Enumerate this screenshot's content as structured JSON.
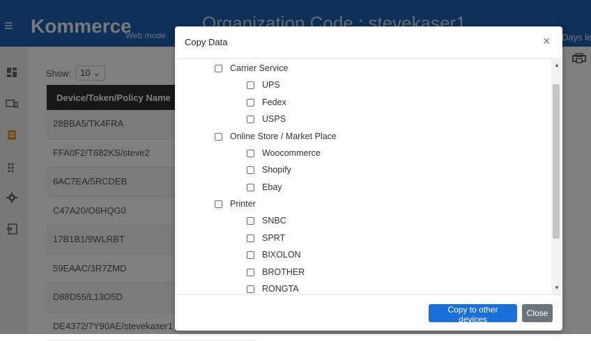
{
  "app": {
    "brand": "Kommerce",
    "mode": "Web mode",
    "org_title": "Organization Code : stevekaser1",
    "days_left": "Days le"
  },
  "nav_icons": [
    "dashboard-icon",
    "devices-icon",
    "orders-icon",
    "apps-grid-icon",
    "settings-gear-icon",
    "logout-icon"
  ],
  "list": {
    "show_label": "Show:",
    "show_value": "10",
    "column_header": "Device/Token/Policy Name",
    "rows": [
      "28BBA5/TK4FRA",
      "FFA0F2/T682KS/steve2",
      "6AC7EA/5RCDEB",
      "C47A20/O6HQG0",
      "17B1B1/9WLRBT",
      "59EAAC/3R7ZMD",
      "D88D55/L13O5D",
      "DE4372/7Y90AE/stevekaser1"
    ]
  },
  "modal": {
    "title": "Copy Data",
    "close_symbol": "×",
    "groups": [
      {
        "label": "Carrier Service",
        "children": [
          "UPS",
          "Fedex",
          "USPS"
        ]
      },
      {
        "label": "Online Store / Market Place",
        "children": [
          "Woocommerce",
          "Shopify",
          "Ebay"
        ]
      },
      {
        "label": "Printer",
        "children": [
          "SNBC",
          "SPRT",
          "BIXOLON",
          "BROTHER",
          "RONGTA"
        ]
      }
    ],
    "copy_button": "Copy to other devices",
    "close_button": "Close"
  },
  "colors": {
    "topbar": "#1d5fae",
    "primary_button": "#1a6fd8",
    "secondary_button": "#6c757d",
    "table_header": "#2d2f33"
  }
}
